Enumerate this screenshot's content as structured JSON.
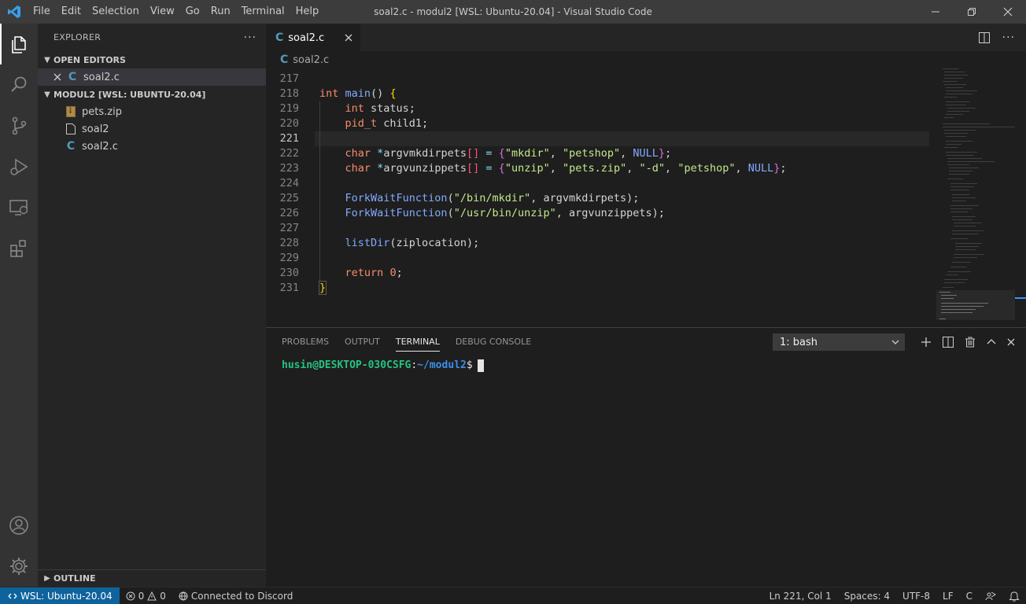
{
  "window": {
    "title": "soal2.c - modul2 [WSL: Ubuntu-20.04] - Visual Studio Code",
    "menu": [
      "File",
      "Edit",
      "Selection",
      "View",
      "Go",
      "Run",
      "Terminal",
      "Help"
    ]
  },
  "sidebar": {
    "title": "EXPLORER",
    "open_editors_label": "OPEN EDITORS",
    "open_editors": [
      {
        "name": "soal2.c",
        "icon": "c-file-icon"
      }
    ],
    "folder_label": "MODUL2 [WSL: UBUNTU-20.04]",
    "files": [
      {
        "name": "pets.zip",
        "icon": "zip-file-icon"
      },
      {
        "name": "soal2",
        "icon": "file-icon"
      },
      {
        "name": "soal2.c",
        "icon": "c-file-icon"
      }
    ],
    "outline_label": "OUTLINE"
  },
  "editor": {
    "tab_label": "soal2.c",
    "breadcrumb": "soal2.c",
    "icon_letter": "C",
    "line_numbers": [
      "217",
      "218",
      "219",
      "220",
      "221",
      "222",
      "223",
      "224",
      "225",
      "226",
      "227",
      "228",
      "229",
      "230",
      "231"
    ],
    "current_line": "221"
  },
  "panel": {
    "tabs": [
      "PROBLEMS",
      "OUTPUT",
      "TERMINAL",
      "DEBUG CONSOLE"
    ],
    "active_tab": "TERMINAL",
    "terminal_select": "1: bash",
    "prompt_user": "husin@DESKTOP-030CSFG",
    "prompt_sep": ":",
    "prompt_path": "~/modul2",
    "prompt_dollar": "$"
  },
  "statusbar": {
    "remote": "WSL: Ubuntu-20.04",
    "errors": "0",
    "warnings": "0",
    "discord": "Connected to Discord",
    "position": "Ln 221, Col 1",
    "spaces": "Spaces: 4",
    "encoding": "UTF-8",
    "eol": "LF",
    "language": "C"
  },
  "colors": {
    "accent": "#0e639c",
    "activity_bar": "#333333",
    "sidebar": "#252526",
    "editor": "#1e1e1e"
  }
}
